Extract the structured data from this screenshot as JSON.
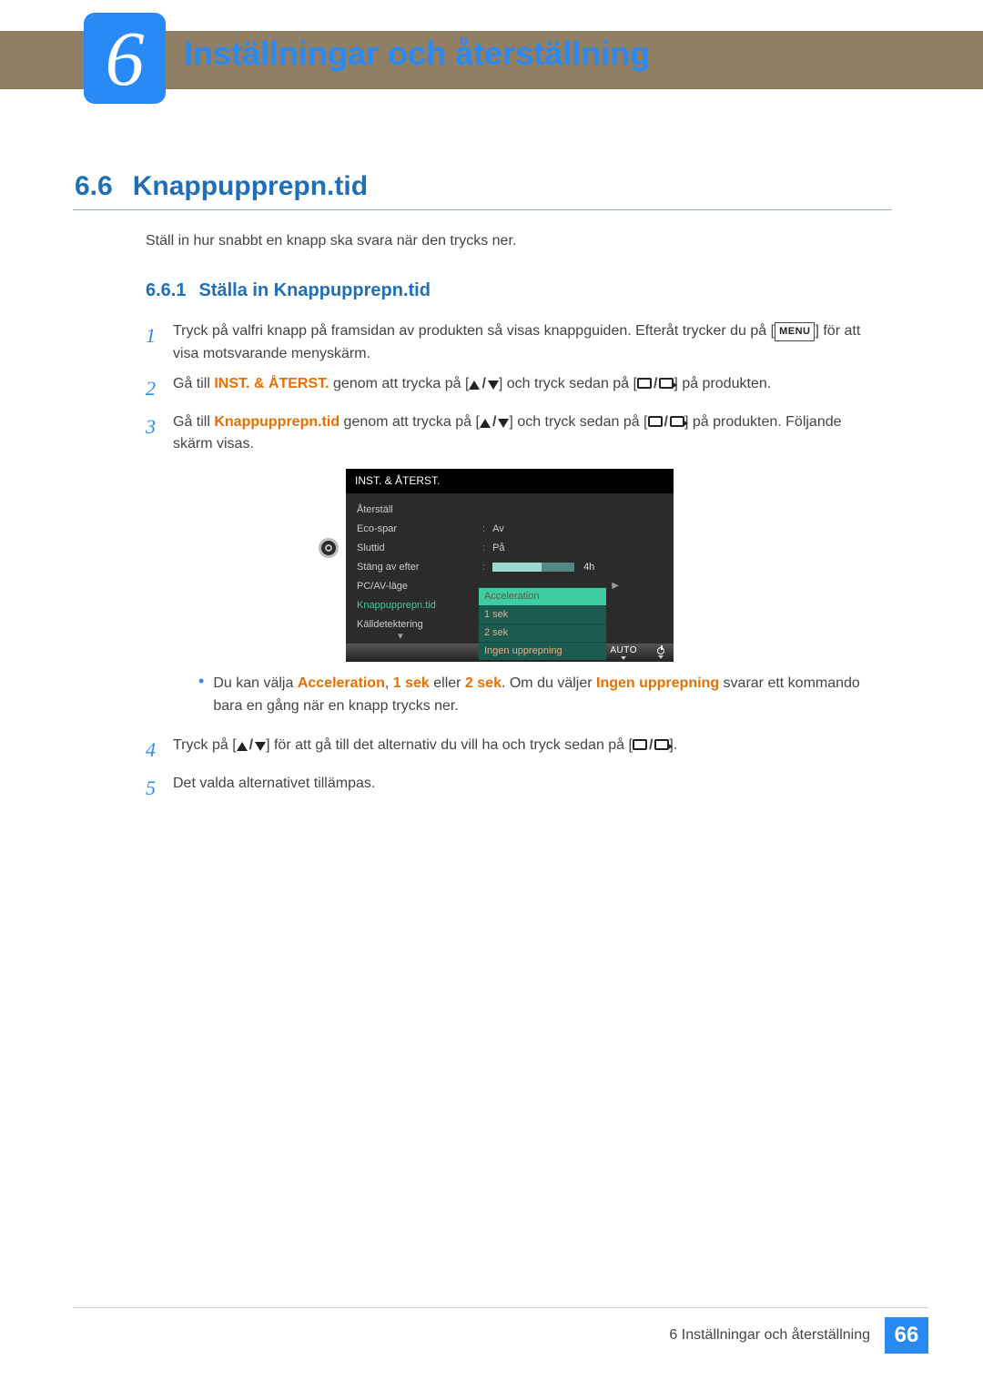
{
  "chapter": {
    "num": "6",
    "title": "Inställningar och återställning"
  },
  "section": {
    "num": "6.6",
    "title": "Knappupprepn.tid"
  },
  "intro": "Ställ in hur snabbt en knapp ska svara när den trycks ner.",
  "subsection": {
    "num": "6.6.1",
    "title": "Ställa in Knappupprepn.tid"
  },
  "steps": {
    "s1a": "Tryck på valfri knapp på framsidan av produkten så visas knappguiden. Efteråt trycker du på [",
    "s1_menu": "MENU",
    "s1b": "] för att visa motsvarande menyskärm.",
    "s2a": "Gå till ",
    "s2_bold": "INST. & ÅTERST.",
    "s2b": " genom att trycka på [",
    "s2c": "] och tryck sedan på [",
    "s2d": "] på produkten.",
    "s3a": "Gå till ",
    "s3_bold": "Knappupprepn.tid",
    "s3b": " genom att trycka på [",
    "s3c": "] och tryck sedan på [",
    "s3d": "] på produkten. Följande skärm visas.",
    "bullet_a": "Du kan välja ",
    "opt1": "Acceleration",
    "comma": ", ",
    "opt2": "1 sek",
    "or": " eller ",
    "opt3": "2 sek",
    "bullet_b": ". Om du väljer ",
    "opt4": "Ingen upprepning",
    "bullet_c": " svarar ett kommando bara en gång när en knapp trycks ner.",
    "s4a": "Tryck på [",
    "s4b": "] för att gå till det alternativ du vill ha och tryck sedan på [",
    "s4c": "].",
    "s5": "Det valda alternativet tillämpas."
  },
  "osd": {
    "title": "INST. & ÅTERST.",
    "items": [
      "Återställ",
      "Eco-spar",
      "Sluttid",
      "Stäng av efter",
      "PC/AV-läge",
      "Knappupprepn.tid",
      "Källdetektering"
    ],
    "vals": {
      "eco": "Av",
      "slut": "På",
      "stang_suffix": "4h"
    },
    "dropdown": [
      "Acceleration",
      "1 sek",
      "2 sek",
      "Ingen upprepning"
    ],
    "footer_auto": "AUTO"
  },
  "footer": {
    "text": "6 Inställningar och återställning",
    "page": "66"
  }
}
